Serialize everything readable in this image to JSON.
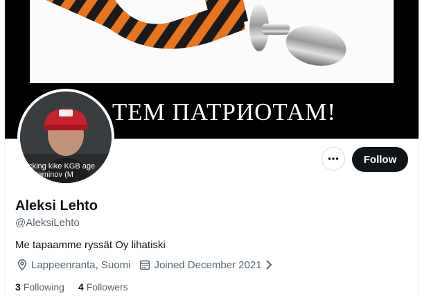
{
  "banner": {
    "caption": "…ТЕМ ПАТРИОТАМ!"
  },
  "avatar": {
    "caption": "ucking kike KGB age\n Ketaminov (M"
  },
  "actions": {
    "more_icon": "more-horizontal-icon",
    "follow_label": "Follow"
  },
  "profile": {
    "name": "Aleksi Lehto",
    "handle": "@AleksiLehto",
    "bio": "Me tapaamme ryssät Oy lihatiski",
    "location": "Lappeenranta, Suomi",
    "joined": "Joined December 2021",
    "location_icon": "location-pin-icon",
    "calendar_icon": "calendar-icon",
    "chevron_icon": "chevron-right-icon"
  },
  "stats": {
    "following_count": "3",
    "following_label": "Following",
    "followers_count": "4",
    "followers_label": "Followers"
  },
  "colors": {
    "text": "#0f1419",
    "secondary": "#536471",
    "button": "#0f1419"
  }
}
